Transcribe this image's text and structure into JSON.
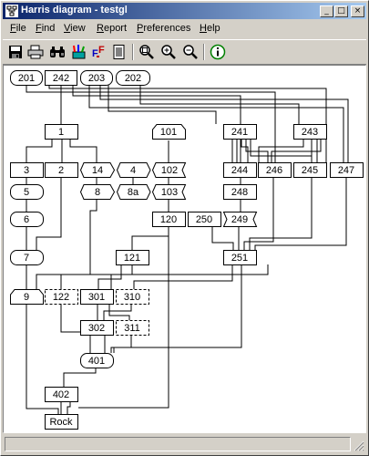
{
  "window": {
    "title": "Harris diagram - testgl"
  },
  "title_buttons": {
    "minimize": "_",
    "maximize": "□",
    "close": "×"
  },
  "menu": [
    {
      "label": "File",
      "hotkey": "F",
      "rest": "ile"
    },
    {
      "label": "Find",
      "hotkey": "F",
      "rest": "ind"
    },
    {
      "label": "View",
      "hotkey": "V",
      "rest": "iew"
    },
    {
      "label": "Report",
      "hotkey": "R",
      "rest": "eport"
    },
    {
      "label": "Preferences",
      "hotkey": "P",
      "rest": "references"
    },
    {
      "label": "Help",
      "hotkey": "H",
      "rest": "elp"
    }
  ],
  "toolbar": [
    "save-icon",
    "print-icon",
    "find-icon",
    "colors-icon",
    "font-icon",
    "page-icon",
    "zoom-fit-icon",
    "zoom-in-icon",
    "zoom-out-icon",
    "info-icon"
  ],
  "nodes": {
    "n201": "201",
    "n242": "242",
    "n203": "203",
    "n202": "202",
    "n1": "1",
    "n101": "101",
    "n241": "241",
    "n243": "243",
    "n3": "3",
    "n2": "2",
    "n14": "14",
    "n4": "4",
    "n102": "102",
    "n244": "244",
    "n246": "246",
    "n245": "245",
    "n247": "247",
    "n5": "5",
    "n8": "8",
    "n8a": "8a",
    "n103": "103",
    "n248": "248",
    "n6": "6",
    "n120": "120",
    "n250": "250",
    "n249": "249",
    "n7": "7",
    "n121": "121",
    "n251": "251",
    "n9": "9",
    "n122": "122",
    "n301": "301",
    "n310": "310",
    "n302": "302",
    "n311": "311",
    "n401": "401",
    "n402": "402",
    "nRock": "Rock"
  },
  "status": {
    "text": ""
  }
}
